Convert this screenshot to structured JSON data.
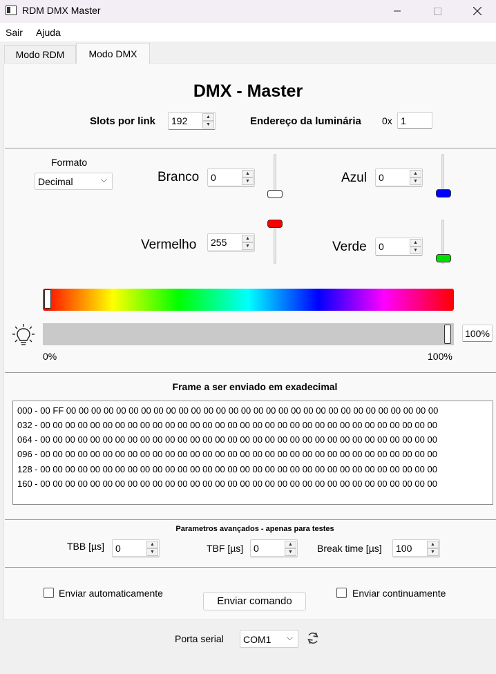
{
  "window": {
    "title": "RDM DMX Master"
  },
  "menu": {
    "items": [
      "Sair",
      "Ajuda"
    ]
  },
  "tabs": [
    "Modo RDM",
    "Modo DMX"
  ],
  "header": {
    "title": "DMX - Master",
    "slots_label": "Slots por link",
    "slots_value": "192",
    "address_label": "Endereço da luminária",
    "address_prefix": "0x",
    "address_value": "1"
  },
  "color": {
    "format_label": "Formato",
    "format_value": "Decimal",
    "white_label": "Branco",
    "white_value": "0",
    "red_label": "Vermelho",
    "red_value": "255",
    "blue_label": "Azul",
    "blue_value": "0",
    "green_label": "Verde",
    "green_value": "0",
    "hue_level": 0,
    "intensity_level": 1.0,
    "intensity_value": "100%",
    "intensity_min_label": "0%",
    "intensity_max_label": "100%"
  },
  "frame": {
    "title": "Frame a ser enviado em exadecimal",
    "lines": [
      "000 - 00 FF 00 00 00 00 00 00 00 00 00 00 00 00 00 00 00 00 00 00 00 00 00 00 00 00 00 00 00 00 00 00",
      "032 - 00 00 00 00 00 00 00 00 00 00 00 00 00 00 00 00 00 00 00 00 00 00 00 00 00 00 00 00 00 00 00 00",
      "064 - 00 00 00 00 00 00 00 00 00 00 00 00 00 00 00 00 00 00 00 00 00 00 00 00 00 00 00 00 00 00 00 00",
      "096 - 00 00 00 00 00 00 00 00 00 00 00 00 00 00 00 00 00 00 00 00 00 00 00 00 00 00 00 00 00 00 00 00",
      "128 - 00 00 00 00 00 00 00 00 00 00 00 00 00 00 00 00 00 00 00 00 00 00 00 00 00 00 00 00 00 00 00 00",
      "160 - 00 00 00 00 00 00 00 00 00 00 00 00 00 00 00 00 00 00 00 00 00 00 00 00 00 00 00 00 00 00 00 00"
    ]
  },
  "advanced": {
    "title": "Parametros avançados - apenas para testes",
    "tbb_label": "TBB [µs]",
    "tbb_value": "0",
    "tbf_label": "TBF [µs]",
    "tbf_value": "0",
    "break_label": "Break time [µs]",
    "break_value": "100"
  },
  "actions": {
    "auto_send_label": "Enviar automaticamente",
    "send_label": "Enviar comando",
    "continuous_label": "Enviar continuamente"
  },
  "serial": {
    "label": "Porta serial",
    "port_value": "COM1"
  },
  "colors": {
    "white_handle": "#ffffff",
    "red_handle": "#ff0000",
    "blue_handle": "#0000ff",
    "green_handle": "#00e000"
  }
}
